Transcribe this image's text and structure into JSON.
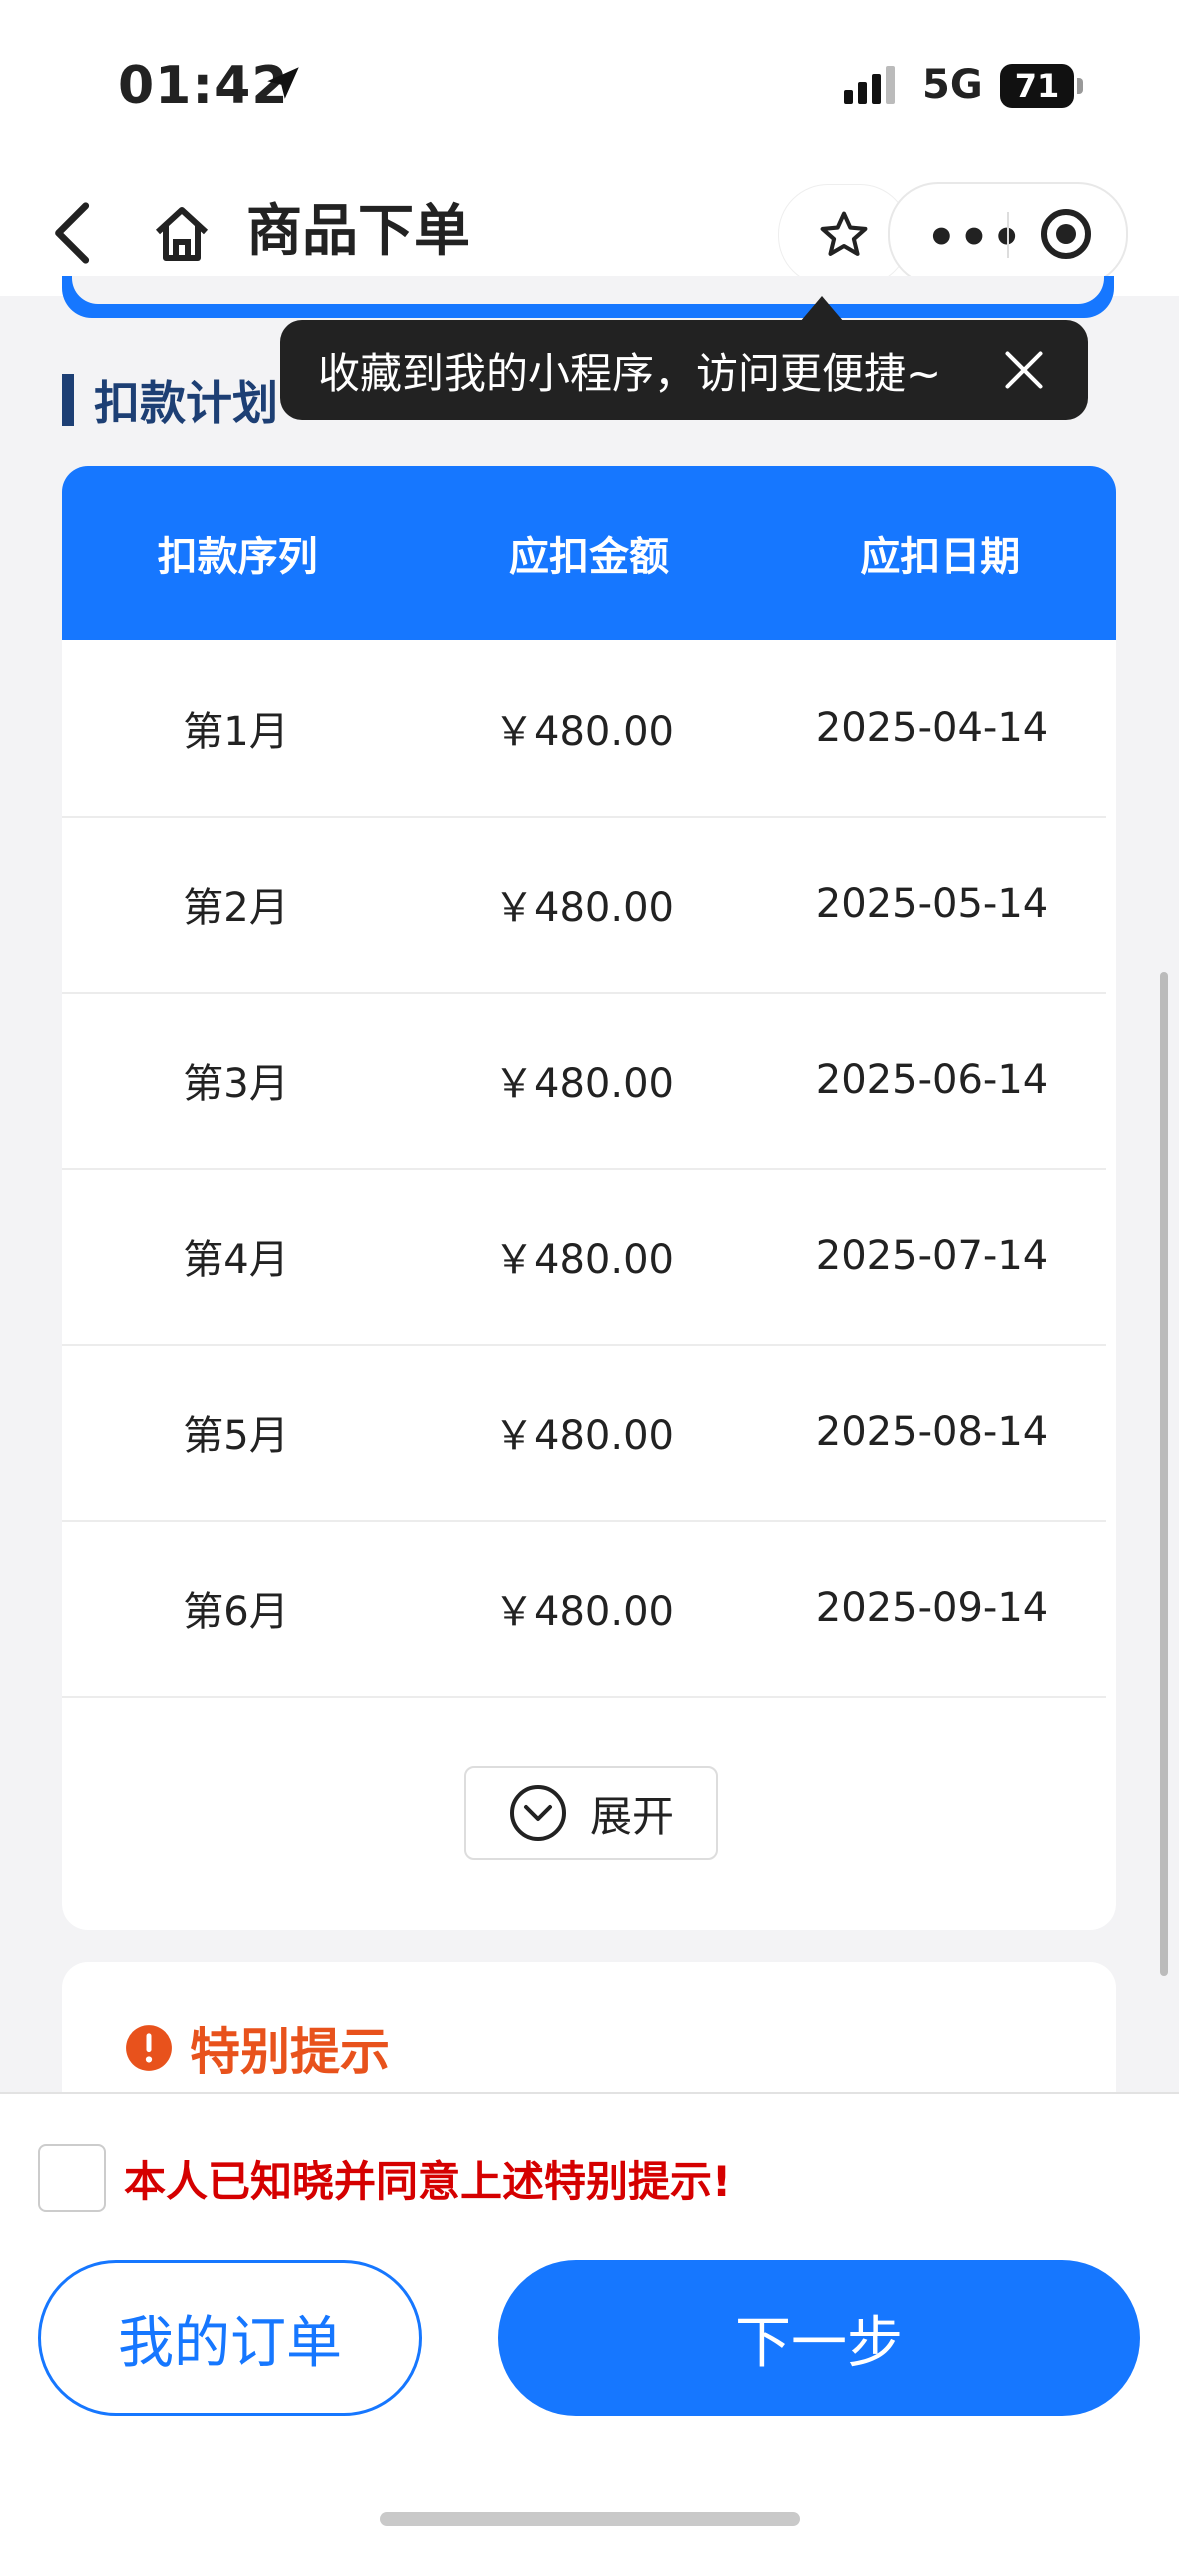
{
  "status_bar": {
    "time": "01:42",
    "network": "5G",
    "battery": "71"
  },
  "nav": {
    "title": "商品下单"
  },
  "tooltip": {
    "text": "收藏到我的小程序，访问更便捷~"
  },
  "section": {
    "title": "扣款计划"
  },
  "table": {
    "headers": [
      "扣款序列",
      "应扣金额",
      "应扣日期"
    ],
    "rows": [
      {
        "seq": "第1月",
        "amount": "￥480.00",
        "date": "2025-04-14"
      },
      {
        "seq": "第2月",
        "amount": "￥480.00",
        "date": "2025-05-14"
      },
      {
        "seq": "第3月",
        "amount": "￥480.00",
        "date": "2025-06-14"
      },
      {
        "seq": "第4月",
        "amount": "￥480.00",
        "date": "2025-07-14"
      },
      {
        "seq": "第5月",
        "amount": "￥480.00",
        "date": "2025-08-14"
      },
      {
        "seq": "第6月",
        "amount": "￥480.00",
        "date": "2025-09-14"
      }
    ],
    "expand_label": "展开"
  },
  "tips": {
    "title": "特别提示"
  },
  "footer": {
    "agree_text": "本人已知晓并同意上述特别提示!",
    "orders_label": "我的订单",
    "next_label": "下一步"
  },
  "colors": {
    "primary": "#1677ff",
    "warning": "#e8521c",
    "agree_red": "#d50000",
    "section_title": "#1d3f74"
  }
}
